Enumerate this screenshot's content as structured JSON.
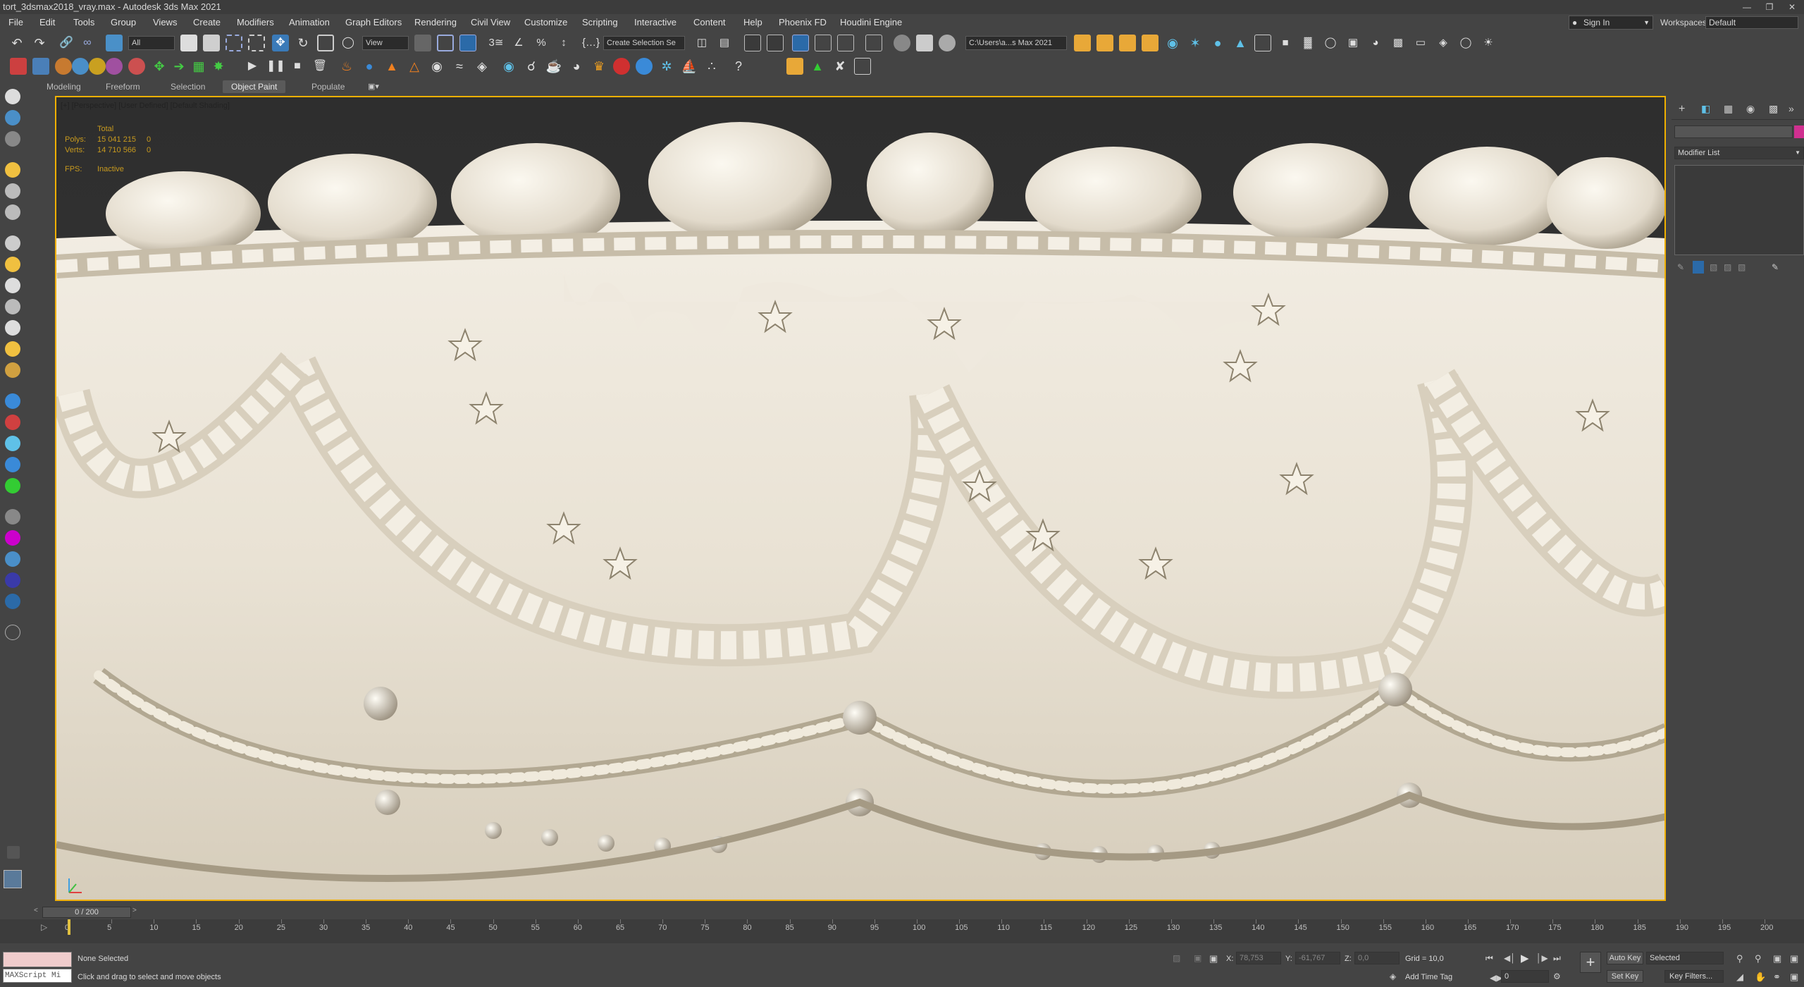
{
  "window": {
    "title": "tort_3dsmax2018_vray.max - Autodesk 3ds Max 2021"
  },
  "menu": [
    "File",
    "Edit",
    "Tools",
    "Group",
    "Views",
    "Create",
    "Modifiers",
    "Animation",
    "Graph Editors",
    "Rendering",
    "Civil View",
    "Customize",
    "Scripting",
    "Interactive",
    "Content",
    "Help",
    "Phoenix FD",
    "Houdini Engine"
  ],
  "account": {
    "sign_in": "Sign In",
    "workspaces_label": "Workspaces:",
    "workspace_value": "Default"
  },
  "toolbar": {
    "selection_filter": "All",
    "reference_coord": "View",
    "named_selection": "Create Selection Se",
    "project_path": "C:\\Users\\a...s Max 2021"
  },
  "ribbon": {
    "tabs": [
      "Modeling",
      "Freeform",
      "Selection",
      "Object Paint",
      "Populate"
    ],
    "active": "Object Paint"
  },
  "viewport": {
    "label": "[+] [Perspective] [User Defined] [Default Shading]",
    "stats": {
      "total_label": "Total",
      "polys_label": "Polys:",
      "polys_total": "15 041 215",
      "polys_sel": "0",
      "verts_label": "Verts:",
      "verts_total": "14 710 566",
      "verts_sel": "0",
      "fps_label": "FPS:",
      "fps_value": "Inactive"
    }
  },
  "command_panel": {
    "modifier_list": "Modifier List"
  },
  "timeline": {
    "frame_display": "0 / 200",
    "ticks": [
      "0",
      "5",
      "10",
      "15",
      "20",
      "25",
      "30",
      "35",
      "40",
      "45",
      "50",
      "55",
      "60",
      "65",
      "70",
      "75",
      "80",
      "85",
      "90",
      "95",
      "100",
      "105",
      "110",
      "115",
      "120",
      "125",
      "130",
      "135",
      "140",
      "145",
      "150",
      "155",
      "160",
      "165",
      "170",
      "175",
      "180",
      "185",
      "190",
      "195",
      "200"
    ]
  },
  "status": {
    "selection": "None Selected",
    "prompt": "Click and drag to select and move objects",
    "maxscript": "MAXScript Mi",
    "x_label": "X:",
    "x_value": "78,753",
    "y_label": "Y:",
    "y_value": "-61,767",
    "z_label": "Z:",
    "z_value": "0,0",
    "grid": "Grid = 10,0",
    "add_time_tag": "Add Time Tag",
    "auto_key": "Auto Key",
    "set_key": "Set Key",
    "key_mode": "Selected",
    "key_filters": "Key Filters...",
    "frame_value": "0"
  },
  "colors": {
    "accent_selection": "#f0b000",
    "model_base": "#e8e2d6"
  }
}
